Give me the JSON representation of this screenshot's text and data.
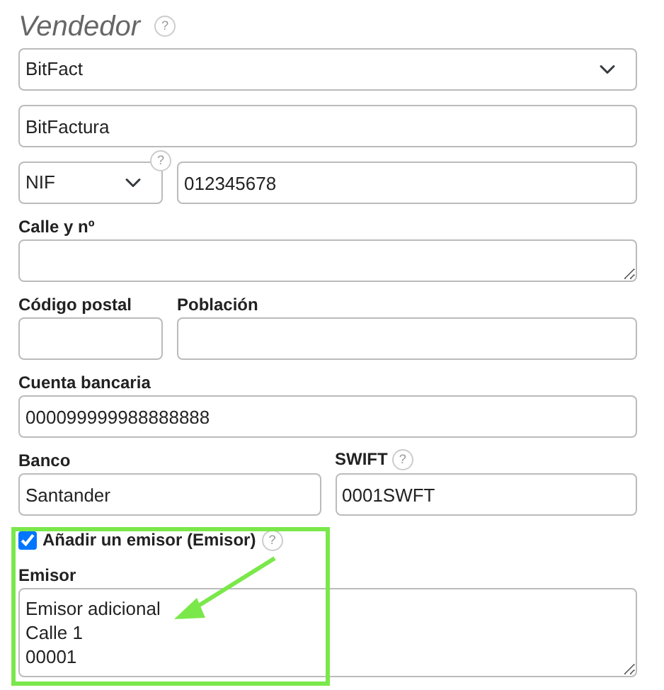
{
  "section_title": "Vendedor",
  "section_help": "?",
  "seller_select": {
    "value": "BitFact"
  },
  "name_field": {
    "value": "BitFactura"
  },
  "tax_id": {
    "type": "NIF",
    "value": "012345678",
    "help": "?"
  },
  "street": {
    "label": "Calle y nº"
  },
  "postal_code": {
    "label": "Código postal"
  },
  "town": {
    "label": "Población"
  },
  "bank_account": {
    "label": "Cuenta bancaria",
    "value": "000099999988888888"
  },
  "bank": {
    "label": "Banco",
    "value": "Santander"
  },
  "swift": {
    "label": "SWIFT",
    "value": "0001SWFT",
    "help": "?"
  },
  "add_issuer": {
    "label": "Añadir un emisor (Emisor)",
    "checked": true,
    "help": "?"
  },
  "issuer": {
    "label": "Emisor",
    "lines": [
      "Emisor adicional",
      "Calle 1",
      "00001"
    ]
  }
}
